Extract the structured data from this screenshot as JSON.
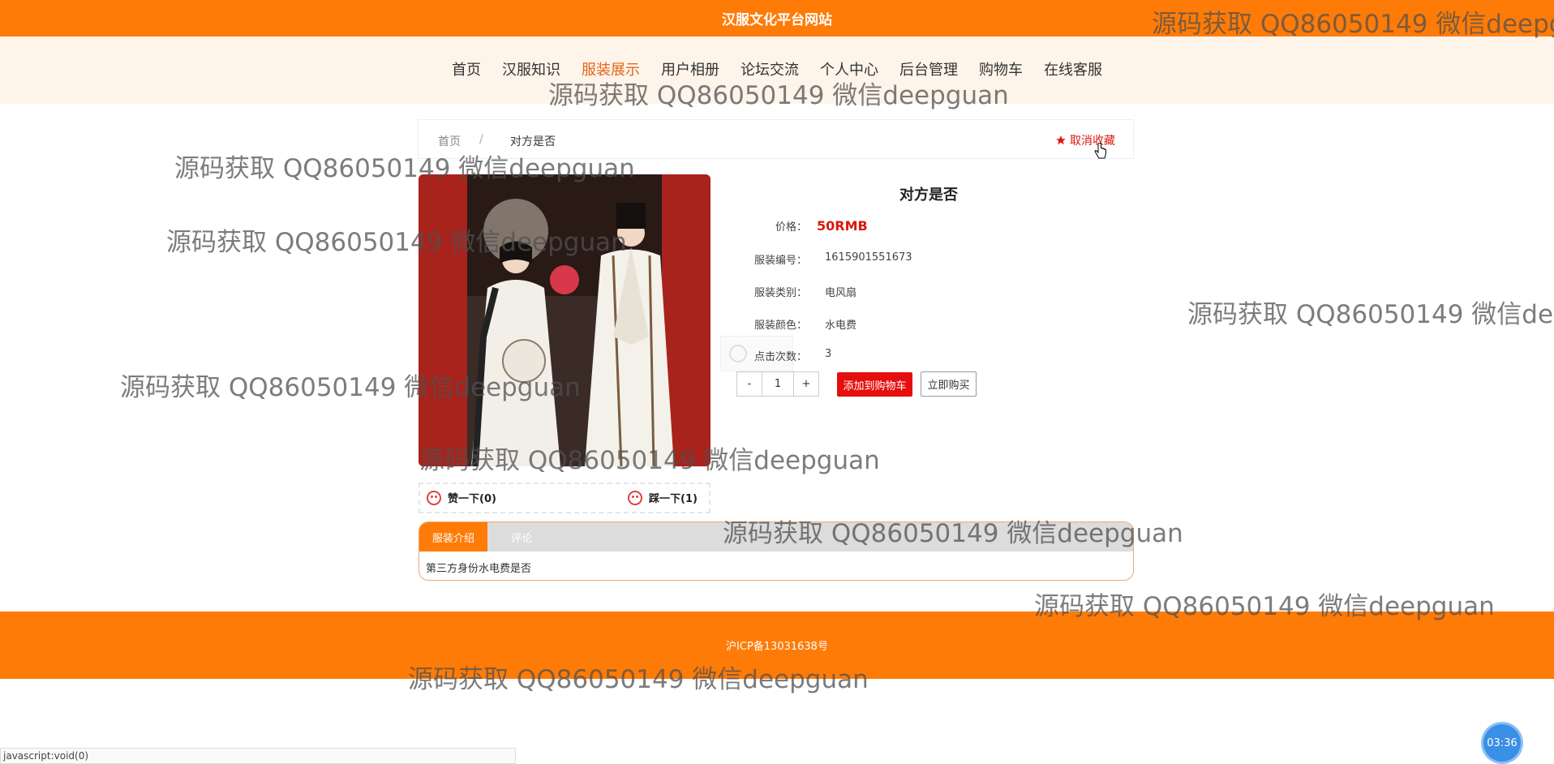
{
  "site": {
    "title": "汉服文化平台网站"
  },
  "nav": {
    "items": [
      "首页",
      "汉服知识",
      "服装展示",
      "用户相册",
      "论坛交流",
      "个人中心",
      "后台管理",
      "购物车",
      "在线客服"
    ],
    "active_index": 2
  },
  "breadcrumb": {
    "home": "首页",
    "separator": "/",
    "current": "对方是否",
    "favorite_label": "取消收藏"
  },
  "product": {
    "title": "对方是否",
    "price_label": "价格：",
    "price_value": "50RMB",
    "code_label": "服装编号：",
    "code_value": "1615901551673",
    "category_label": "服装类别：",
    "category_value": "电风扇",
    "color_label": "服装颜色：",
    "color_value": "水电费",
    "clicks_label": "点击次数：",
    "clicks_value": "3"
  },
  "votes": {
    "like_label": "赞一下(0)",
    "dislike_label": "踩一下(1)"
  },
  "purchase": {
    "minus_label": "-",
    "quantity": "1",
    "plus_label": "+",
    "add_cart_label": "添加到购物车",
    "buy_now_label": "立即购买"
  },
  "tabs": {
    "items": [
      "服装介绍",
      "评论"
    ],
    "active_index": 0,
    "content": "第三方身份水电费是否"
  },
  "footer": {
    "icp": "沪ICP备13031638号"
  },
  "status_bar": {
    "text": "javascript:void(0)"
  },
  "timer": {
    "text": "03:36"
  },
  "watermark": {
    "text": "源码获取 QQ86050149 微信deepguan"
  },
  "colors": {
    "primary": "#ff7b07",
    "price": "#d9190d",
    "cart_button": "#e50d0d",
    "nav_bg": "#fff4ea"
  },
  "icons": {
    "favorite": "star-icon",
    "like": "smile-icon",
    "dislike": "frown-icon"
  }
}
